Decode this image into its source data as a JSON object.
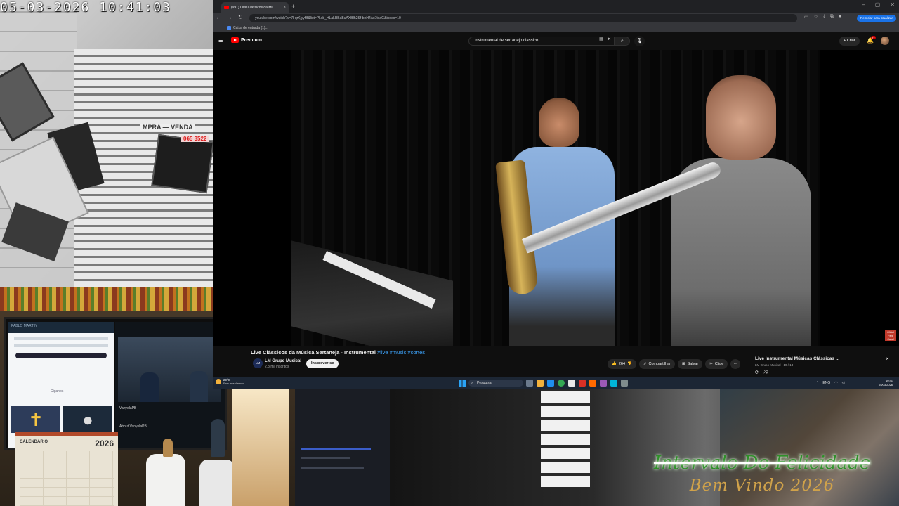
{
  "cctv": {
    "timestamp": "05-03-2026  10:41:03",
    "sign_text": "MPRA — VENDA",
    "sign_phone": "065 3522"
  },
  "webcam": {
    "monitor_left_heading": "PABLO MARTIN",
    "monitor_left_caption": "Ciganos",
    "monitor_right_channel": "VanyelaPB",
    "monitor_right_about": "About VanyelaPB",
    "calendar_title": "CALENDÁRIO",
    "calendar_year": "2026"
  },
  "overlay_banner": {
    "title": "Intervalo Do Felicidade",
    "subtitle": "Bem Vindo 2026"
  },
  "browser": {
    "tab_title": "(991) Live Clássicos da Mú...",
    "tab_close": "×",
    "new_tab": "+",
    "window_controls": [
      "–",
      "▢",
      "✕"
    ],
    "url": "youtube.com/watch?v=7l-qrKjyyfB&list=PLcb_HLaLBBaBuAXBIh2Sf-bnH4Ax7tcaG&index=10",
    "update_button": "Reiniciar para atualizar",
    "bookmark": "Caixa de entrada (1)..."
  },
  "youtube": {
    "brand": "Premium",
    "search_value": "instrumental de sertanejo classico",
    "create_label": "Criar",
    "notif_count": "9+",
    "video": {
      "title": "Live Clássicos da Música Sertaneja - Instrumental",
      "hashtags": "#live #music #cortes",
      "watermark": "Oficial Para Canal"
    },
    "channel": {
      "avatar_text": "LM",
      "name": "LM Grupo Musical",
      "subscribers": "2,3 mil inscritos",
      "subscribe_label": "Inscrever-se"
    },
    "actions": {
      "likes": "264",
      "share": "Compartilhar",
      "save": "Salvar",
      "clip": "Clipe",
      "more": "···"
    },
    "playlist": {
      "title": "Live Instrumental Músicas Clássicas ...",
      "subtitle": "LM Grupo Musical · 10 / 13"
    }
  },
  "taskbar": {
    "temp": "29°C",
    "condition": "Parc ensolarado",
    "search_placeholder": "Pesquisar",
    "lang": "ENG",
    "time": "10:41",
    "date": "05/03/2026"
  }
}
